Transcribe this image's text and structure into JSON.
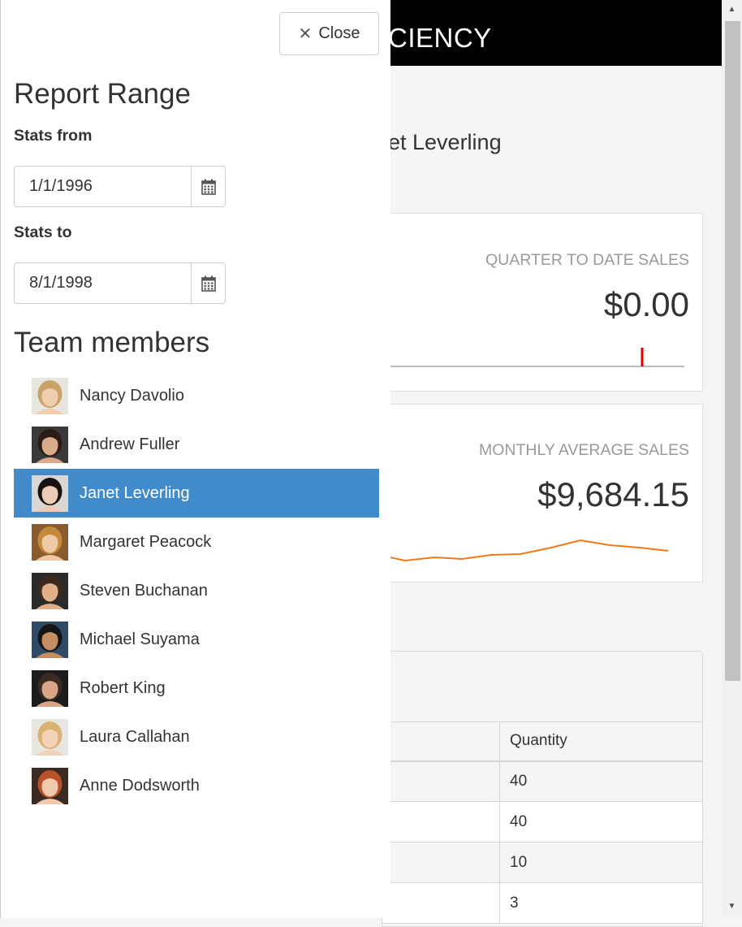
{
  "app": {
    "title": "CIENCY"
  },
  "employee": {
    "name": "et Leverling"
  },
  "cards": {
    "qtd": {
      "label": "QUARTER TO DATE SALES",
      "value": "$0.00"
    },
    "avg": {
      "label": "MONTHLY AVERAGE SALES",
      "value": "$9,684.15"
    }
  },
  "orders_grid": {
    "header": [
      "",
      "Quantity"
    ],
    "rows": [
      [
        "",
        "40"
      ],
      [
        "",
        "40"
      ],
      [
        "",
        "10"
      ],
      [
        "",
        "3"
      ]
    ]
  },
  "drawer": {
    "close_label": "Close",
    "range_title": "Report Range",
    "stats_from_label": "Stats from",
    "stats_from_value": "1/1/1996",
    "stats_to_label": "Stats to",
    "stats_to_value": "8/1/1998",
    "team_title": "Team members",
    "members": [
      {
        "name": "Nancy Davolio",
        "selected": false,
        "hair": "#c9a26a",
        "skin": "#f1cdb0",
        "bg": "#e8e4de"
      },
      {
        "name": "Andrew Fuller",
        "selected": false,
        "hair": "#2b1d16",
        "skin": "#d9ab8c",
        "bg": "#3a3a3a"
      },
      {
        "name": "Janet Leverling",
        "selected": true,
        "hair": "#1a1210",
        "skin": "#eccbb6",
        "bg": "#d9d6d3"
      },
      {
        "name": "Margaret Peacock",
        "selected": false,
        "hair": "#c48a3a",
        "skin": "#f0c9a6",
        "bg": "#8a5b2e"
      },
      {
        "name": "Steven Buchanan",
        "selected": false,
        "hair": "#3b2a1d",
        "skin": "#e0b08a",
        "bg": "#2a2a2a"
      },
      {
        "name": "Michael Suyama",
        "selected": false,
        "hair": "#151515",
        "skin": "#c58d62",
        "bg": "#2f4a66"
      },
      {
        "name": "Robert King",
        "selected": false,
        "hair": "#3a2b22",
        "skin": "#d8a588",
        "bg": "#1c1c1c"
      },
      {
        "name": "Laura Callahan",
        "selected": false,
        "hair": "#d8b372",
        "skin": "#f3d2b8",
        "bg": "#e9e6e2"
      },
      {
        "name": "Anne Dodsworth",
        "selected": false,
        "hair": "#b8522a",
        "skin": "#f3c9ad",
        "bg": "#3a2a22"
      }
    ]
  },
  "colors": {
    "header_bg": "#000000",
    "selected_bg": "#428bca",
    "sparkline_orange": "#f07a1a",
    "marker_red": "#e00000"
  }
}
